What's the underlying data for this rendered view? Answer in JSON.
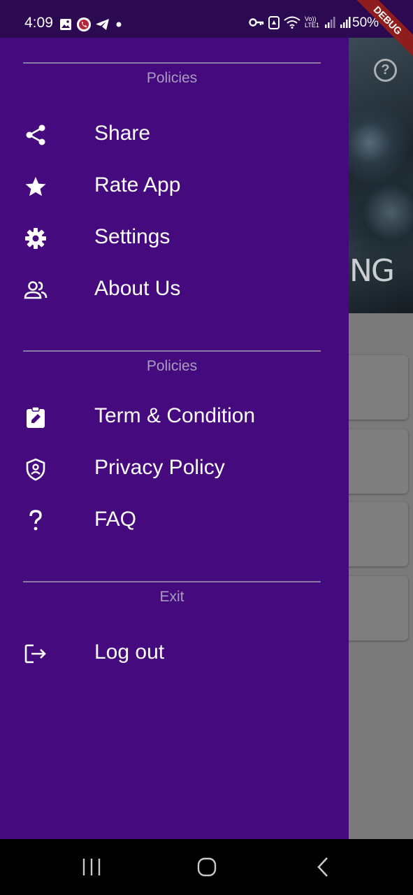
{
  "status_bar": {
    "time": "4:09",
    "battery": "50%",
    "network": "Vo)) LTE1"
  },
  "debug_banner": "DEBUG",
  "drawer": {
    "sections": [
      {
        "title": "Policies",
        "items": [
          {
            "label": "Share",
            "icon": "share-icon"
          },
          {
            "label": "Rate App",
            "icon": "star-icon"
          },
          {
            "label": "Settings",
            "icon": "gear-icon"
          },
          {
            "label": "About Us",
            "icon": "people-icon"
          }
        ]
      },
      {
        "title": "Policies",
        "items": [
          {
            "label": "Term & Condition",
            "icon": "clipboard-edit-icon"
          },
          {
            "label": "Privacy Policy",
            "icon": "shield-icon"
          },
          {
            "label": "FAQ",
            "icon": "question-icon"
          }
        ]
      },
      {
        "title": "Exit",
        "items": [
          {
            "label": "Log out",
            "icon": "logout-icon"
          }
        ]
      }
    ]
  },
  "background": {
    "hero_text": "NG"
  },
  "colors": {
    "drawer_bg": "#450b7e",
    "status_bar_bg": "#2c0a52",
    "scrim": "#7a7a7a"
  }
}
